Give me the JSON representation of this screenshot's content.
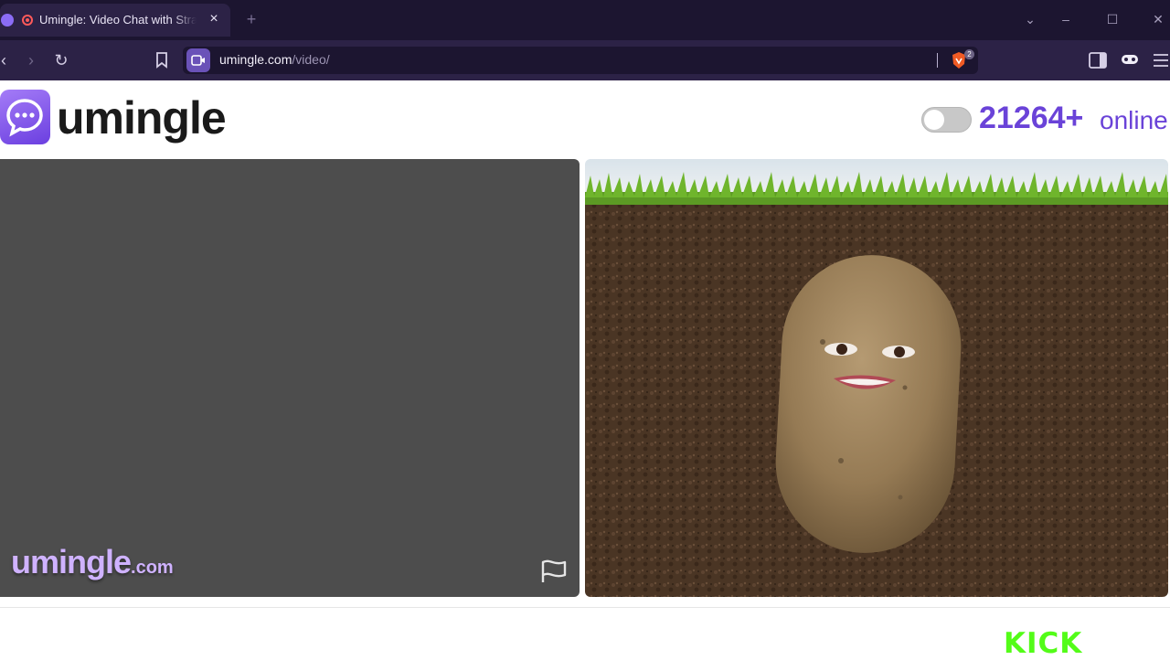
{
  "browser": {
    "tab": {
      "title": "Umingle: Video Chat with Strangers",
      "close": "×"
    },
    "new_tab": "+",
    "window_controls": {
      "minimize": "–",
      "maximize": "☐",
      "close": "✕",
      "tab_list": "⌄"
    },
    "address": {
      "host": "umingle.com",
      "path": "/video/"
    },
    "brave_shield_count": "2",
    "nav": {
      "back": "‹",
      "forward": "›",
      "reload": "↻"
    },
    "icons": [
      "bookmark-icon",
      "sidebar-icon",
      "brave-wallet-icon",
      "menu-icon"
    ]
  },
  "page": {
    "logo_text": "umingle",
    "online_count": "21264+",
    "online_label": "online",
    "watermark_main": "umingle",
    "watermark_domain": ".com",
    "footer_brand": "KICK"
  },
  "colors": {
    "accent": "#6a43d8",
    "chrome_dark": "#1c1530",
    "chrome": "#2c2246",
    "video_bg": "#4d4d4d",
    "kick_green": "#53fc18"
  }
}
